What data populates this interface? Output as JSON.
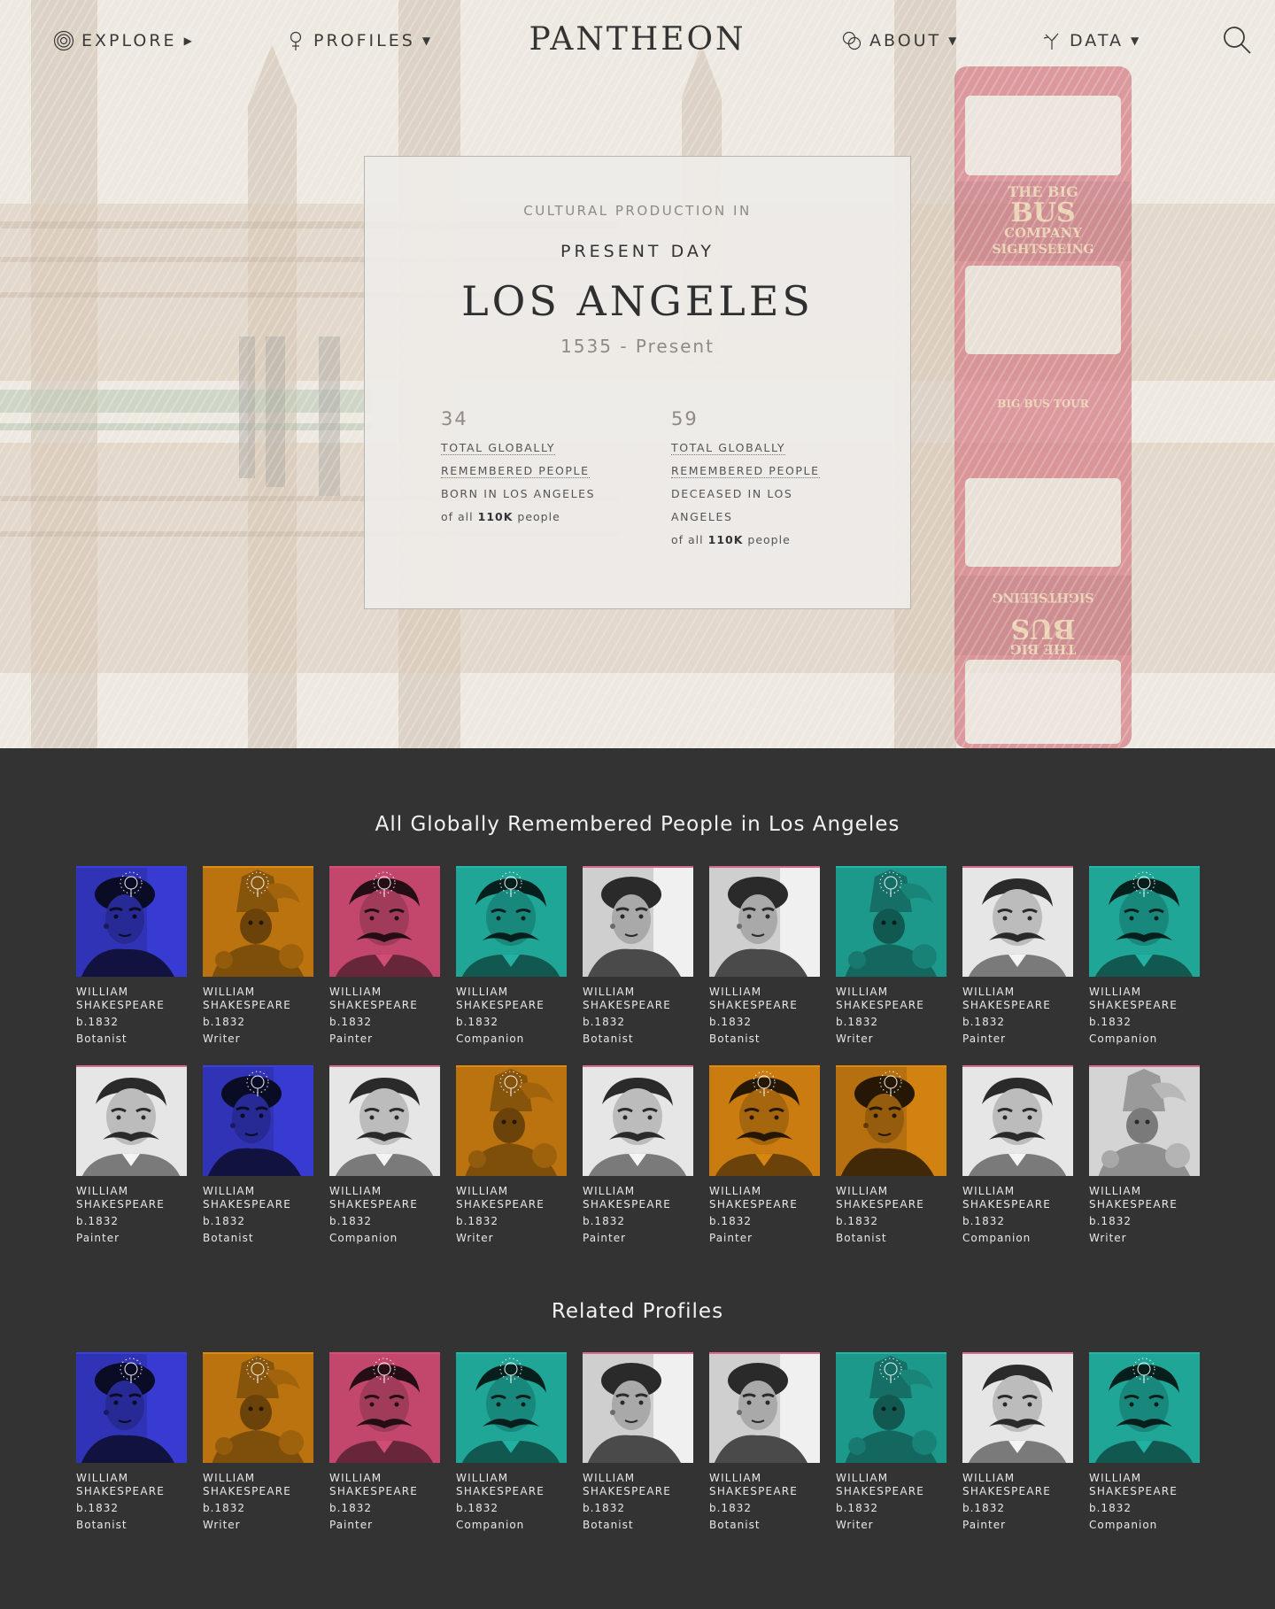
{
  "nav": {
    "explore": "Explore",
    "profiles": "Profiles",
    "logo": "PANTHEON",
    "about": "About",
    "data": "Data"
  },
  "hero": {
    "kicker": "Cultural Production in",
    "era": "Present Day",
    "title": "Los Angeles",
    "dates": "1535 - Present",
    "stat_born": {
      "value": "34",
      "line1": "Total globally",
      "line2": "remembered people",
      "line3": "born in Los Angeles",
      "of_prefix": "of all",
      "of_value": "110K",
      "of_suffix": "people"
    },
    "stat_died": {
      "value": "59",
      "line1": "Total globally",
      "line2": "remembered people",
      "line3": "deceased in Los",
      "line4": "Angeles",
      "of_prefix": "of all",
      "of_value": "110K",
      "of_suffix": "people"
    }
  },
  "people_section": {
    "title": "All Globally Remembered People in Los Angeles",
    "rows": [
      [
        {
          "name1": "William",
          "name2": "Shakespeare",
          "birth": "b.1832",
          "occupation": "Botanist",
          "tint": "#3b3ee0",
          "portrait": "frida",
          "badge": true
        },
        {
          "name1": "William",
          "name2": "Shakespeare",
          "birth": "b.1832",
          "occupation": "Writer",
          "tint": "#e08a12",
          "portrait": "idol",
          "badge": true
        },
        {
          "name1": "William",
          "name2": "Shakespeare",
          "birth": "b.1832",
          "occupation": "Painter",
          "tint": "#d94f78",
          "portrait": "mustache",
          "badge": true
        },
        {
          "name1": "William",
          "name2": "Shakespeare",
          "birth": "b.1832",
          "occupation": "Companion",
          "tint": "#22b8a8",
          "portrait": "mustache",
          "badge": true
        },
        {
          "name1": "William",
          "name2": "Shakespeare",
          "birth": "b.1832",
          "occupation": "Botanist",
          "tint": "#ffffff",
          "portrait": "frida",
          "badge": false
        },
        {
          "name1": "William",
          "name2": "Shakespeare",
          "birth": "b.1832",
          "occupation": "Botanist",
          "tint": "#ffffff",
          "portrait": "frida",
          "badge": false
        },
        {
          "name1": "William",
          "name2": "Shakespeare",
          "birth": "b.1832",
          "occupation": "Writer",
          "tint": "#22b8a8",
          "portrait": "idol",
          "badge": true
        },
        {
          "name1": "William",
          "name2": "Shakespeare",
          "birth": "b.1832",
          "occupation": "Painter",
          "tint": "#ffffff",
          "portrait": "mustache",
          "badge": false
        },
        {
          "name1": "William",
          "name2": "Shakespeare",
          "birth": "b.1832",
          "occupation": "Companion",
          "tint": "#22b8a8",
          "portrait": "mustache",
          "badge": true
        }
      ],
      [
        {
          "name1": "William",
          "name2": "Shakespeare",
          "birth": "b.1832",
          "occupation": "Painter",
          "tint": "#ffffff",
          "portrait": "mustache",
          "badge": false
        },
        {
          "name1": "William",
          "name2": "Shakespeare",
          "birth": "b.1832",
          "occupation": "Botanist",
          "tint": "#3b3ee0",
          "portrait": "frida",
          "badge": true
        },
        {
          "name1": "William",
          "name2": "Shakespeare",
          "birth": "b.1832",
          "occupation": "Companion",
          "tint": "#ffffff",
          "portrait": "mustache",
          "badge": false
        },
        {
          "name1": "William",
          "name2": "Shakespeare",
          "birth": "b.1832",
          "occupation": "Writer",
          "tint": "#e08a12",
          "portrait": "idol",
          "badge": true
        },
        {
          "name1": "William",
          "name2": "Shakespeare",
          "birth": "b.1832",
          "occupation": "Painter",
          "tint": "#ffffff",
          "portrait": "mustache",
          "badge": false
        },
        {
          "name1": "William",
          "name2": "Shakespeare",
          "birth": "b.1832",
          "occupation": "Painter",
          "tint": "#e08a12",
          "portrait": "mustache",
          "badge": true
        },
        {
          "name1": "William",
          "name2": "Shakespeare",
          "birth": "b.1832",
          "occupation": "Botanist",
          "tint": "#e08a12",
          "portrait": "frida",
          "badge": true
        },
        {
          "name1": "William",
          "name2": "Shakespeare",
          "birth": "b.1832",
          "occupation": "Companion",
          "tint": "#ffffff",
          "portrait": "mustache",
          "badge": false
        },
        {
          "name1": "William",
          "name2": "Shakespeare",
          "birth": "b.1832",
          "occupation": "Writer",
          "tint": "#ffffff",
          "portrait": "idol",
          "badge": false
        }
      ]
    ]
  },
  "related_section": {
    "title": "Related Profiles",
    "items": [
      {
        "name1": "William",
        "name2": "Shakespeare",
        "birth": "b.1832",
        "occupation": "Botanist",
        "tint": "#3b3ee0",
        "portrait": "frida",
        "badge": true
      },
      {
        "name1": "William",
        "name2": "Shakespeare",
        "birth": "b.1832",
        "occupation": "Writer",
        "tint": "#e08a12",
        "portrait": "idol",
        "badge": true
      },
      {
        "name1": "William",
        "name2": "Shakespeare",
        "birth": "b.1832",
        "occupation": "Painter",
        "tint": "#d94f78",
        "portrait": "mustache",
        "badge": true
      },
      {
        "name1": "William",
        "name2": "Shakespeare",
        "birth": "b.1832",
        "occupation": "Companion",
        "tint": "#22b8a8",
        "portrait": "mustache",
        "badge": true
      },
      {
        "name1": "William",
        "name2": "Shakespeare",
        "birth": "b.1832",
        "occupation": "Botanist",
        "tint": "#ffffff",
        "portrait": "frida",
        "badge": false
      },
      {
        "name1": "William",
        "name2": "Shakespeare",
        "birth": "b.1832",
        "occupation": "Botanist",
        "tint": "#ffffff",
        "portrait": "frida",
        "badge": false
      },
      {
        "name1": "William",
        "name2": "Shakespeare",
        "birth": "b.1832",
        "occupation": "Writer",
        "tint": "#22b8a8",
        "portrait": "idol",
        "badge": true
      },
      {
        "name1": "William",
        "name2": "Shakespeare",
        "birth": "b.1832",
        "occupation": "Painter",
        "tint": "#ffffff",
        "portrait": "mustache",
        "badge": false
      },
      {
        "name1": "William",
        "name2": "Shakespeare",
        "birth": "b.1832",
        "occupation": "Companion",
        "tint": "#22b8a8",
        "portrait": "mustache",
        "badge": true
      }
    ]
  },
  "icons": {
    "explore": "explore-icon",
    "profiles": "profiles-icon",
    "about": "about-icon",
    "data": "data-icon",
    "search": "search-icon",
    "caret_right": "caret-right-icon",
    "caret_down": "caret-down-icon"
  }
}
